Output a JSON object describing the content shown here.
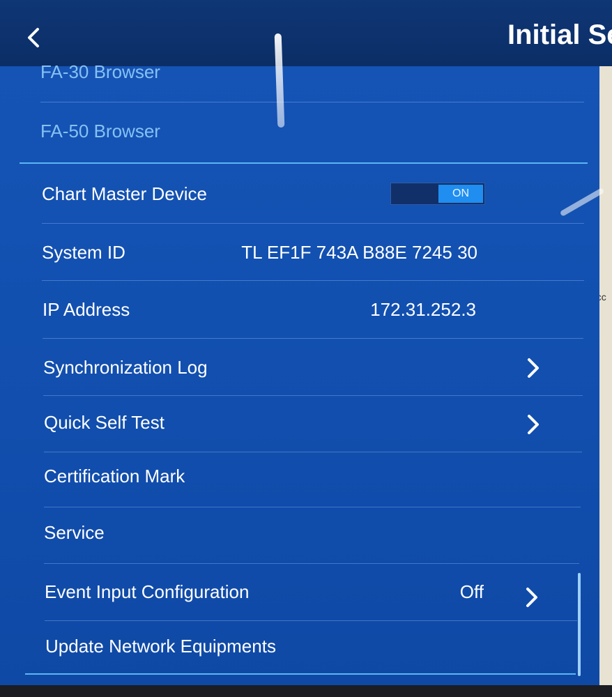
{
  "header": {
    "title": "Initial Se"
  },
  "menu": {
    "browsers": [
      {
        "label": "FA-30 Browser"
      },
      {
        "label": "FA-50 Browser"
      }
    ],
    "chart_master_device": {
      "label": "Chart Master Device",
      "toggle_state": "ON"
    },
    "system_id": {
      "label": "System ID",
      "value": "TL EF1F 743A B88E 7245 30"
    },
    "ip_address": {
      "label": "IP Address",
      "value": "172.31.252.3"
    },
    "synchronization_log": {
      "label": "Synchronization Log"
    },
    "quick_self_test": {
      "label": "Quick Self Test"
    },
    "certification_mark": {
      "label": "Certification Mark"
    },
    "service": {
      "label": "Service"
    },
    "event_input_configuration": {
      "label": "Event Input Configuration",
      "value": "Off"
    },
    "update_network_equipments": {
      "label": "Update Network Equipments"
    }
  },
  "side_panel": {
    "partial_text": "occ"
  },
  "colors": {
    "header_bg": "#0b2e66",
    "panel_bg": "#1250b0",
    "accent_line": "#5cb7f5",
    "toggle_on": "#1f8ef0",
    "dim_text": "#86c1f3"
  },
  "icons": {
    "back": "chevron-left-icon",
    "row_arrow": "chevron-right-icon"
  }
}
